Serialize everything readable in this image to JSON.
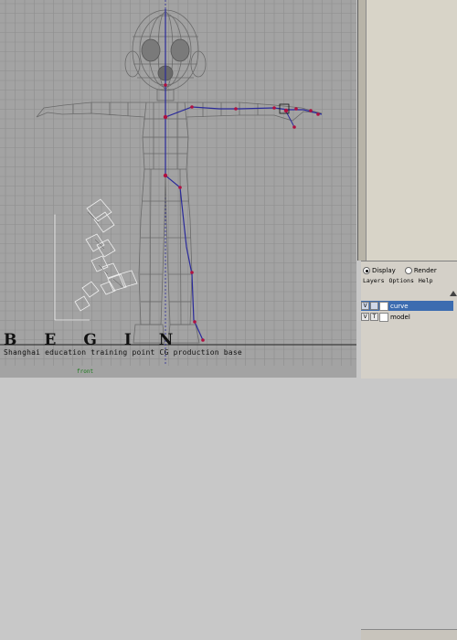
{
  "viewport": {
    "camera_label": "front",
    "banner_title": "BEGIN",
    "banner_subtitle": "Shanghai education training point CG production base"
  },
  "layer_editor": {
    "tabs": [
      {
        "label": "Display",
        "selected": true
      },
      {
        "label": "Render",
        "selected": false
      }
    ],
    "menu": [
      "Layers",
      "Options",
      "Help"
    ],
    "layers": [
      {
        "visible": "V",
        "type": "",
        "name": "curve",
        "selected": true
      },
      {
        "visible": "V",
        "type": "T",
        "name": "model",
        "selected": false
      }
    ]
  },
  "colors": {
    "viewport_bg": "#a3a3a3",
    "grid_line": "#8a8a8a",
    "wireframe": "#6e6e6e",
    "curve": "#2a2a9a",
    "cv_point": "#b01040",
    "selected_layer": "#3c6cb0"
  }
}
